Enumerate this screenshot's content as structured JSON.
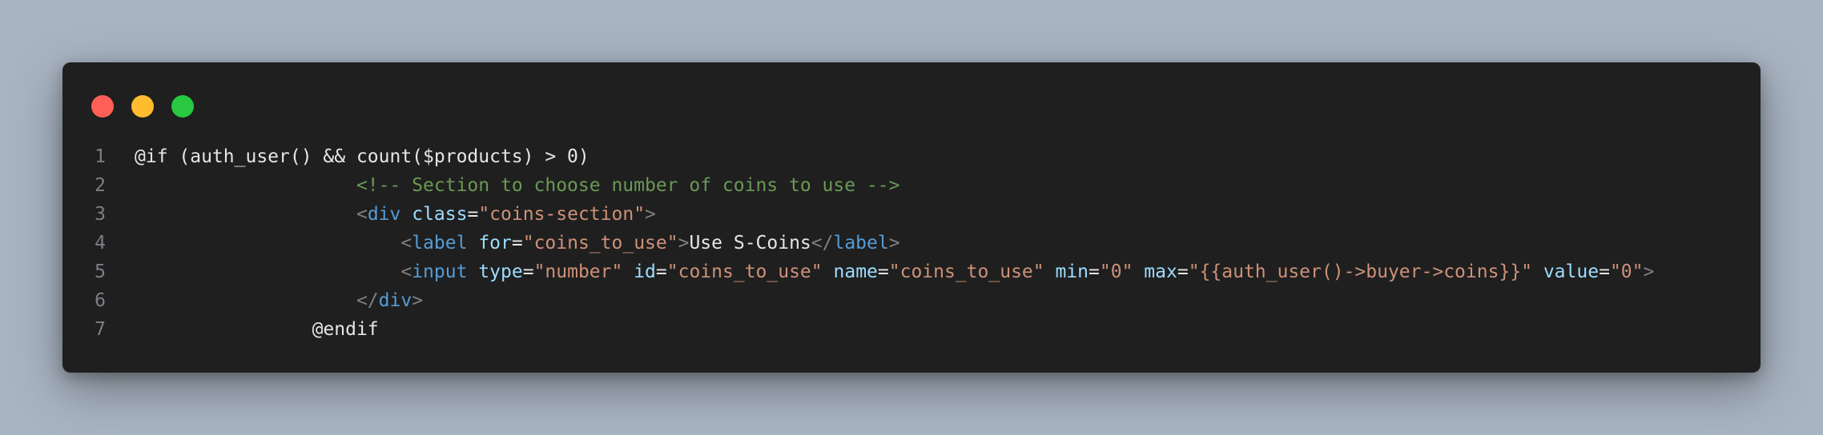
{
  "window": {
    "controls": {
      "close_color": "#ff5f57",
      "minimize_color": "#febc2e",
      "maximize_color": "#28c840"
    }
  },
  "code": {
    "lines": [
      {
        "number": "1",
        "indent": "",
        "tokens": [
          {
            "t": "plain",
            "v": "@if (auth_user() && count($products) > 0)"
          }
        ]
      },
      {
        "number": "2",
        "indent": "                    ",
        "tokens": [
          {
            "t": "comment",
            "v": "<!-- Section to choose number of coins to use -->"
          }
        ]
      },
      {
        "number": "3",
        "indent": "                    ",
        "tokens": [
          {
            "t": "bracket",
            "v": "<"
          },
          {
            "t": "tag",
            "v": "div"
          },
          {
            "t": "plain",
            "v": " "
          },
          {
            "t": "attr",
            "v": "class"
          },
          {
            "t": "plain",
            "v": "="
          },
          {
            "t": "string",
            "v": "\"coins-section\""
          },
          {
            "t": "bracket",
            "v": ">"
          }
        ]
      },
      {
        "number": "4",
        "indent": "                        ",
        "tokens": [
          {
            "t": "bracket",
            "v": "<"
          },
          {
            "t": "tag",
            "v": "label"
          },
          {
            "t": "plain",
            "v": " "
          },
          {
            "t": "attr",
            "v": "for"
          },
          {
            "t": "plain",
            "v": "="
          },
          {
            "t": "string",
            "v": "\"coins_to_use\""
          },
          {
            "t": "bracket",
            "v": ">"
          },
          {
            "t": "text",
            "v": "Use S-Coins"
          },
          {
            "t": "bracket",
            "v": "</"
          },
          {
            "t": "tag",
            "v": "label"
          },
          {
            "t": "bracket",
            "v": ">"
          }
        ]
      },
      {
        "number": "5",
        "indent": "                        ",
        "tokens": [
          {
            "t": "bracket",
            "v": "<"
          },
          {
            "t": "tag",
            "v": "input"
          },
          {
            "t": "plain",
            "v": " "
          },
          {
            "t": "attr",
            "v": "type"
          },
          {
            "t": "plain",
            "v": "="
          },
          {
            "t": "string",
            "v": "\"number\""
          },
          {
            "t": "plain",
            "v": " "
          },
          {
            "t": "attr",
            "v": "id"
          },
          {
            "t": "plain",
            "v": "="
          },
          {
            "t": "string",
            "v": "\"coins_to_use\""
          },
          {
            "t": "plain",
            "v": " "
          },
          {
            "t": "attr",
            "v": "name"
          },
          {
            "t": "plain",
            "v": "="
          },
          {
            "t": "string",
            "v": "\"coins_to_use\""
          },
          {
            "t": "plain",
            "v": " "
          },
          {
            "t": "attr",
            "v": "min"
          },
          {
            "t": "plain",
            "v": "="
          },
          {
            "t": "string",
            "v": "\"0\""
          },
          {
            "t": "plain",
            "v": " "
          },
          {
            "t": "attr",
            "v": "max"
          },
          {
            "t": "plain",
            "v": "="
          },
          {
            "t": "string",
            "v": "\"{{auth_user()->buyer->coins}}\""
          },
          {
            "t": "plain",
            "v": " "
          },
          {
            "t": "attr",
            "v": "value"
          },
          {
            "t": "plain",
            "v": "="
          },
          {
            "t": "string",
            "v": "\"0\""
          },
          {
            "t": "bracket",
            "v": ">"
          }
        ]
      },
      {
        "number": "6",
        "indent": "                    ",
        "tokens": [
          {
            "t": "bracket",
            "v": "</"
          },
          {
            "t": "tag",
            "v": "div"
          },
          {
            "t": "bracket",
            "v": ">"
          }
        ]
      },
      {
        "number": "7",
        "indent": "                ",
        "tokens": [
          {
            "t": "plain",
            "v": "@endif"
          }
        ]
      }
    ]
  }
}
